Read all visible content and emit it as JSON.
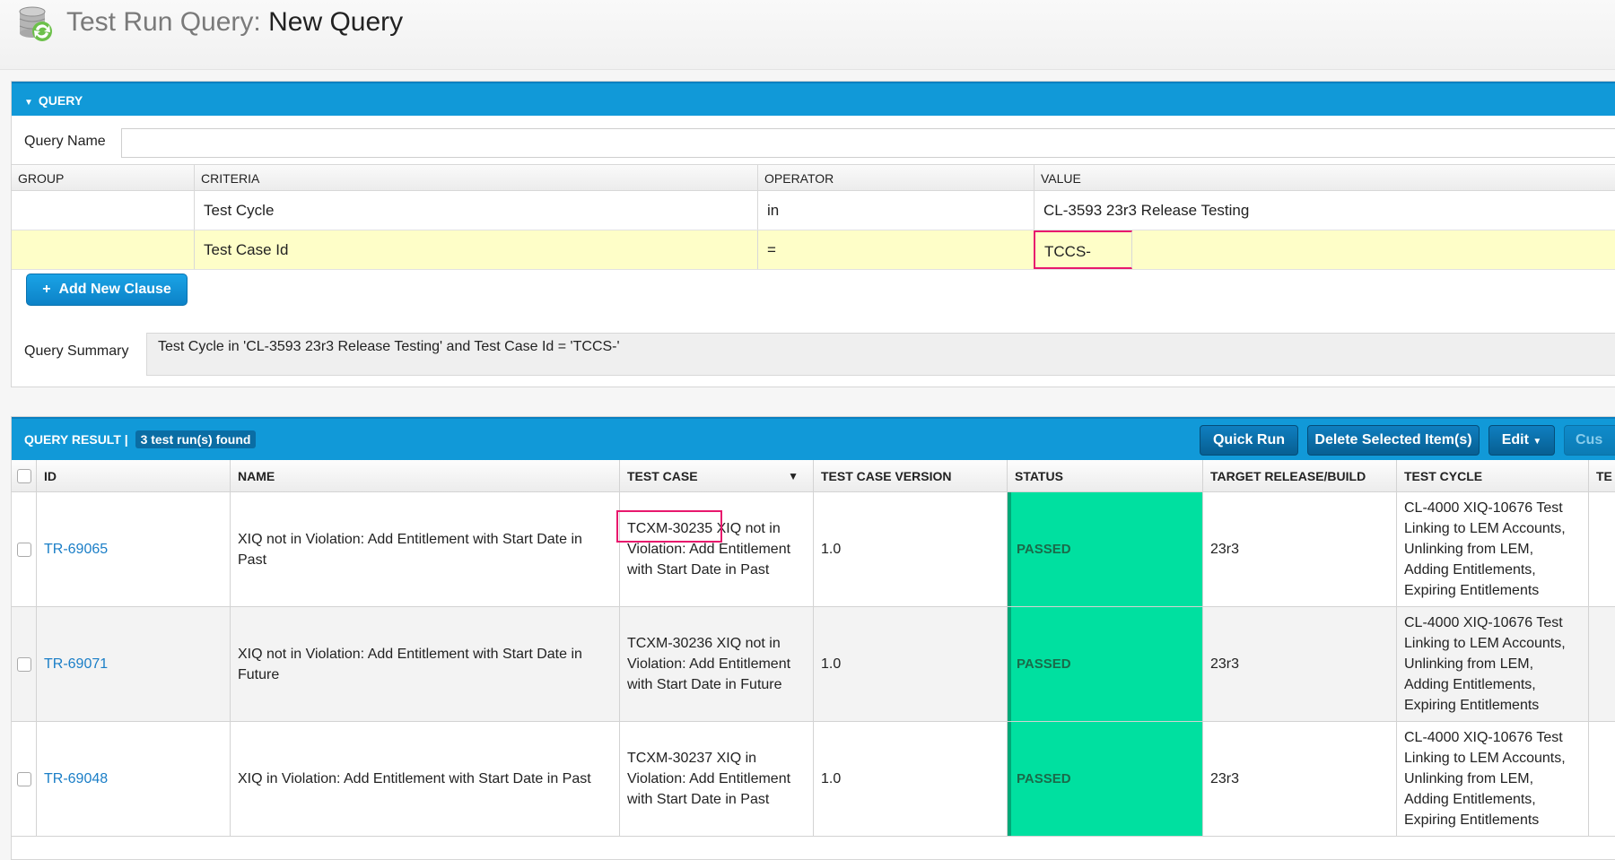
{
  "header": {
    "title_prefix": "Test Run Query:",
    "title_name": "New Query"
  },
  "query_panel": {
    "title": "QUERY",
    "query_name_label": "Query Name",
    "query_name_value": "",
    "columns": [
      "GROUP",
      "CRITERIA",
      "OPERATOR",
      "VALUE"
    ],
    "rows": [
      {
        "group": "",
        "criteria": "Test Cycle",
        "operator": "in",
        "value": "CL-3593 23r3 Release Testing"
      },
      {
        "group": "",
        "criteria": "Test Case Id",
        "operator": "=",
        "value": "TCCS-"
      }
    ],
    "add_clause_label": "Add New Clause",
    "summary_label": "Query Summary",
    "summary_text": "Test Cycle in 'CL-3593 23r3 Release Testing' and   Test Case Id = 'TCCS-'"
  },
  "results_panel": {
    "title": "QUERY RESULT |",
    "count_badge": "3 test run(s) found",
    "buttons": {
      "quick_run": "Quick Run",
      "delete_selected": "Delete Selected Item(s)",
      "edit": "Edit",
      "custom": "Cus"
    },
    "columns": {
      "id": "ID",
      "name": "NAME",
      "test_case": "TEST CASE",
      "version": "TEST CASE VERSION",
      "status": "STATUS",
      "target": "TARGET RELEASE/BUILD",
      "cycle": "TEST CYCLE",
      "extra": "TE"
    },
    "rows": [
      {
        "id": "TR-69065",
        "name": "XIQ not in Violation: Add Entitlement with Start Date in Past",
        "test_case_id": "TCXM-30235",
        "test_case_rest": " XIQ not in Violation: Add Entitlement with Start Date in Past",
        "version": "1.0",
        "status": "PASSED",
        "target": "23r3",
        "cycle": "CL-4000 XIQ-10676 Test Linking to LEM Accounts, Unlinking from LEM, Adding Entitlements, Expiring Entitlements"
      },
      {
        "id": "TR-69071",
        "name": "XIQ not in Violation: Add Entitlement with Start Date in Future",
        "test_case_id": "TCXM-30236",
        "test_case_rest": " XIQ not in Violation: Add Entitlement with Start Date in Future",
        "version": "1.0",
        "status": "PASSED",
        "target": "23r3",
        "cycle": "CL-4000 XIQ-10676 Test Linking to LEM Accounts, Unlinking from LEM, Adding Entitlements, Expiring Entitlements"
      },
      {
        "id": "TR-69048",
        "name": "XIQ in Violation: Add Entitlement with Start Date in Past",
        "test_case_id": "TCXM-30237",
        "test_case_rest": " XIQ in Violation: Add Entitlement with Start Date in Past",
        "version": "1.0",
        "status": "PASSED",
        "target": "23r3",
        "cycle": "CL-4000 XIQ-10676 Test Linking to LEM Accounts, Unlinking from LEM, Adding Entitlements, Expiring Entitlements"
      }
    ]
  },
  "colors": {
    "panel_header": "#1199d8",
    "passed_status": "#00e0a0",
    "highlight_row": "#fefec8",
    "annotation_box": "#e8186d",
    "link": "#1a7ec7"
  }
}
